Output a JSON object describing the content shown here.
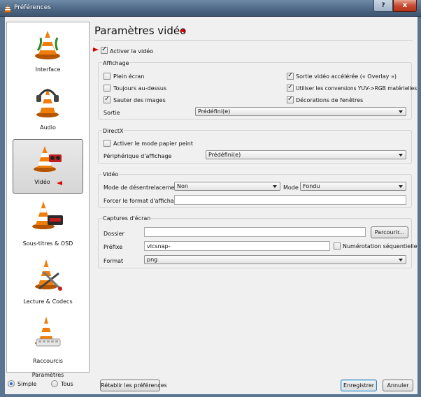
{
  "window": {
    "title": "Préférences",
    "help_label": "?",
    "close_label": "x"
  },
  "sidebar": {
    "categories": [
      {
        "label": "Interface",
        "icon": "vlc-cone-interface-icon"
      },
      {
        "label": "Audio",
        "icon": "vlc-cone-headphones-icon"
      },
      {
        "label": "Vidéo",
        "icon": "vlc-cone-glasses-icon",
        "selected": true
      },
      {
        "label": "Sous-titres & OSD",
        "icon": "vlc-cone-display-icon"
      },
      {
        "label": "Lecture & Codecs",
        "icon": "vlc-cone-tools-icon"
      },
      {
        "label": "Raccourcis",
        "icon": "vlc-cone-keyboard-icon"
      }
    ],
    "params_title": "Paramètres",
    "simple_label": "Simple",
    "tous_label": "Tous",
    "selected_mode": "Simple"
  },
  "main": {
    "title": "Paramètres vidéo",
    "enable_video": {
      "label": "Activer la vidéo",
      "checked": true
    },
    "affichage": {
      "title": "Affichage",
      "plein_ecran": {
        "label": "Plein écran",
        "checked": false
      },
      "toujours_dessus": {
        "label": "Toujours au-dessus",
        "checked": false
      },
      "sauter_images": {
        "label": "Sauter des images",
        "checked": true
      },
      "overlay": {
        "label": "Sortie vidéo accélérée (« Overlay »)",
        "checked": true
      },
      "yuv_rgb": {
        "label": "Utiliser les conversions YUV->RGB matérielles",
        "checked": true
      },
      "decorations": {
        "label": "Décorations de fenêtres",
        "checked": true
      },
      "sortie_label": "Sortie",
      "sortie_value": "Prédéfini(e)"
    },
    "directx": {
      "title": "DirectX",
      "papier_peint": {
        "label": "Activer le mode papier peint",
        "checked": false
      },
      "peripherique_label": "Périphérique d'affichage",
      "peripherique_value": "Prédéfini(e)"
    },
    "video": {
      "title": "Vidéo",
      "desentrelacement_label": "Mode de désentrelacement",
      "desentrelacement_value": "Non",
      "mode_label": "Mode",
      "mode_value": "Fondu",
      "forcer_label": "Forcer le format d'affichage",
      "forcer_value": ""
    },
    "captures": {
      "title": "Captures d'écran",
      "dossier_label": "Dossier",
      "dossier_value": "",
      "parcourir_label": "Parcourir...",
      "prefixe_label": "Préfixe",
      "prefixe_value": "vlcsnap-",
      "numerotation": {
        "label": "Numérotation séquentielle",
        "checked": false
      },
      "format_label": "Format",
      "format_value": "png"
    }
  },
  "footer": {
    "reset_label": "Rétablir les préférences",
    "save_label": "Enregistrer",
    "cancel_label": "Annuler"
  },
  "colors": {
    "highlight_arrow": "#e00000",
    "cone_orange": "#f07d0a"
  }
}
